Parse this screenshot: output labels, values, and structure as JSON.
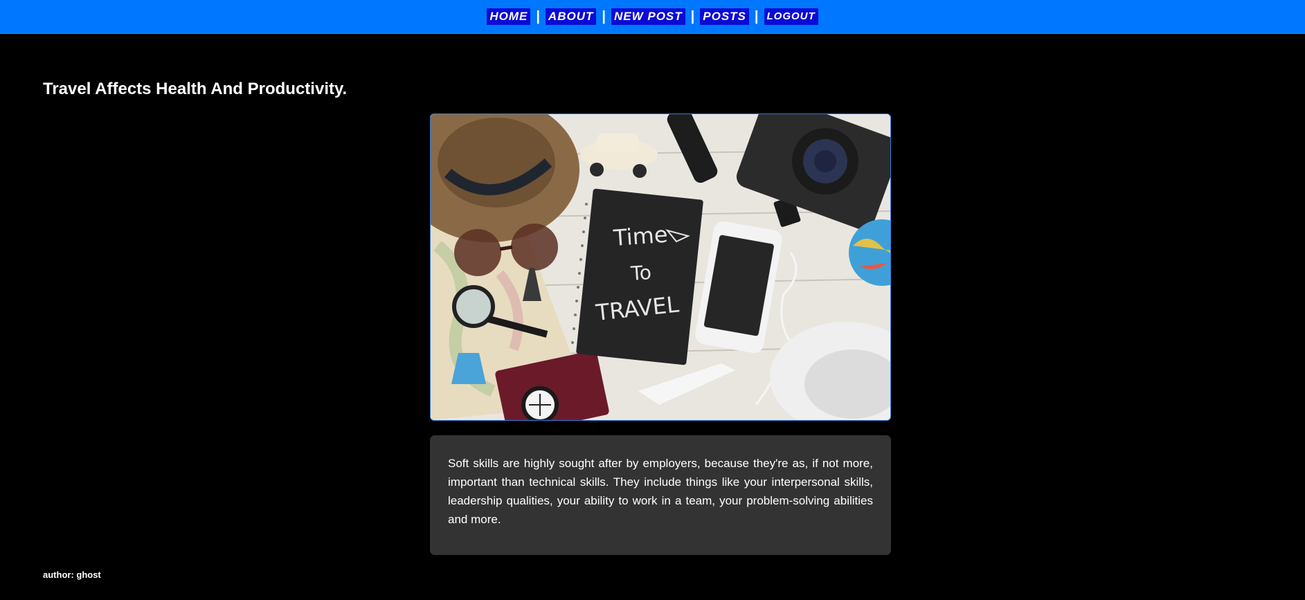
{
  "nav": {
    "home": "HOME",
    "about": "ABOUT",
    "new_post": "NEW POST",
    "posts": "POSTS",
    "logout": "LOGOUT",
    "separator": "|"
  },
  "post": {
    "title": "Travel Affects Health And Productivity.",
    "image_icon": "travel-flatlay-photo",
    "notebook_text": [
      "Time",
      "To",
      "TRAVEL"
    ],
    "body": "Soft skills are highly sought after by employers, because they're as, if not more, important than technical skills. They include things like your interpersonal skills, leadership qualities, your ability to work in a team, your problem-solving abilities and more.",
    "author_line": "author: ghost"
  },
  "colors": {
    "topbar": "#0077ff",
    "nav_link_bg": "#0b0bd6",
    "page_bg": "#000000",
    "content_box_bg": "#333333",
    "image_border": "#2f7de1"
  }
}
